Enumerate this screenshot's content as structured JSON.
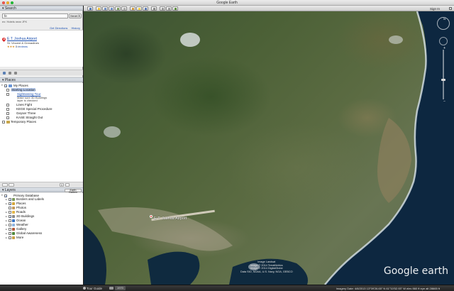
{
  "window": {
    "title": "Google Earth"
  },
  "toolbar": {
    "tooltip": "Add Path",
    "sign_in": "Sign In"
  },
  "search": {
    "header": "Search",
    "query": "fe",
    "button": "Search",
    "hint": "ex: Hotels near JFK",
    "get_directions": "Get Directions",
    "history": "History",
    "result": {
      "letter": "A",
      "name": "E.T. Joshua Airport",
      "location": "St. Vincent & Grenadines",
      "stars": "★★★☆☆",
      "reviews": "3 reviews"
    }
  },
  "places": {
    "header": "Places",
    "items": [
      {
        "label": "My Places"
      },
      {
        "label": "Starting Location"
      },
      {
        "label": "Sightseeing Tour"
      },
      {
        "label": "Make sure 3D Buildings"
      },
      {
        "label": "layer is checked"
      },
      {
        "label": "Lines Fight"
      },
      {
        "label": "KEGE Special Procedure"
      },
      {
        "label": "Geyser Three"
      },
      {
        "label": "KASE Straight Out"
      },
      {
        "label": "Temporary Places"
      }
    ],
    "footer_button": "Earth Gallery",
    "footer_symbol": "»"
  },
  "layers": {
    "header": "Layers",
    "items": [
      {
        "label": "Primary Database"
      },
      {
        "label": "Borders and Labels"
      },
      {
        "label": "Places"
      },
      {
        "label": "Photos"
      },
      {
        "label": "Roads"
      },
      {
        "label": "3D Buildings"
      },
      {
        "label": "Ocean"
      },
      {
        "label": "Weather"
      },
      {
        "label": "Gallery"
      },
      {
        "label": "Global Awareness"
      },
      {
        "label": "More"
      }
    ]
  },
  "map": {
    "place_label": "E.T. Joshua Airport",
    "copyright": [
      "Image Landsat",
      "Image © 2014 TerraMetrics",
      "Image © 2014 DigitalGlobe",
      "Data SIO, NOAA, U.S. Navy, NGA, GEBCO"
    ],
    "logo": "Google earth"
  },
  "status": {
    "tour_guide": "Tour Guide",
    "year": "1970",
    "info": "Imagery Date: 4/8/2013   13°09'26.65\" N  61°10'52.93\" W  elev  860 ft   eye alt  28665 ft"
  },
  "colors": {
    "ocean": "#0d2740",
    "land": "#4e6238",
    "highlight": "#b9cdf0"
  }
}
